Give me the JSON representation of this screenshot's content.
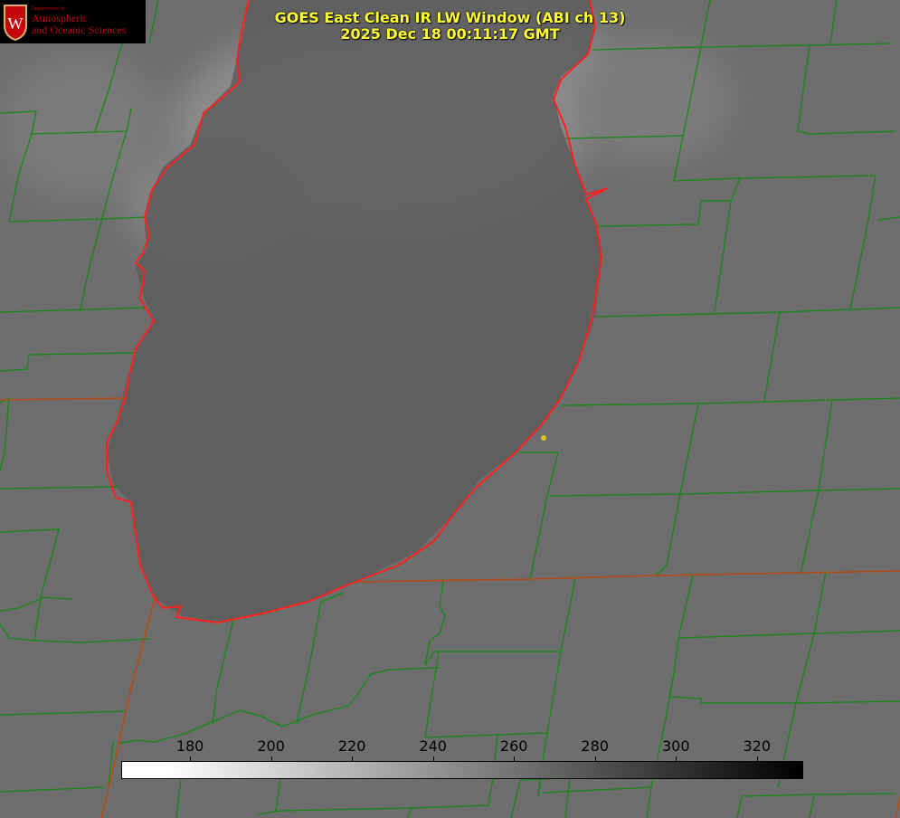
{
  "title": {
    "line1": "GOES East Clean IR LW Window (ABI ch 13)",
    "line2": "2025 Dec 18 00:11:17 GMT"
  },
  "logo": {
    "department": "Department of",
    "line1": "Atmospheric",
    "line2": "and Oceanic Sciences",
    "seal_letter": "W",
    "color": "#c5050c"
  },
  "colorbar": {
    "ticks": [
      "180",
      "200",
      "220",
      "240",
      "260",
      "280",
      "300",
      "320"
    ],
    "range": [
      163,
      331
    ],
    "gradient": "white-to-black"
  },
  "colors": {
    "background_gray": "#6e6e6e",
    "lake_gray": "#5c5c5c",
    "county_lines": "#138a13",
    "state_lines": "#b84a14",
    "coastline": "#ff2020",
    "title_text": "#ffff33",
    "marker": "#d6c21e"
  }
}
